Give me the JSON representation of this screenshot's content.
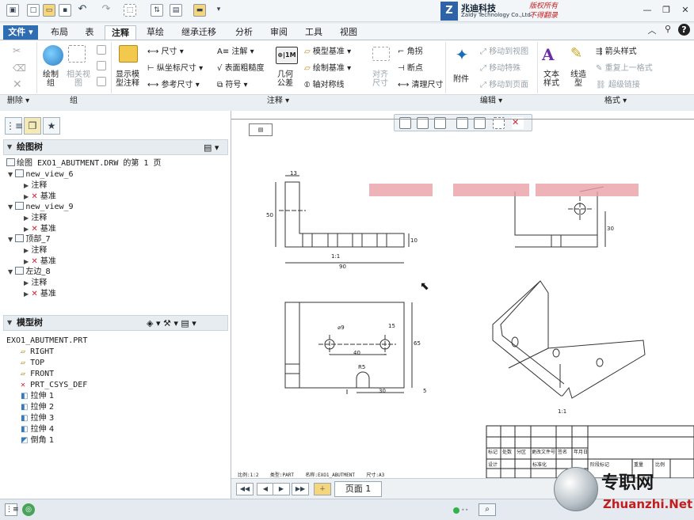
{
  "brand": {
    "name_cn": "兆迪科技",
    "name_en": "Zaldy Technology Co.,Ltd.",
    "slogan1": "版权所有",
    "slogan2": "不得翻录"
  },
  "tabs": [
    "文件",
    "布局",
    "表",
    "注释",
    "草绘",
    "继承迁移",
    "分析",
    "审阅",
    "工具",
    "视图"
  ],
  "active_tab": "注释",
  "ribbon": {
    "delete_group": "删除",
    "group_group": "组",
    "annotation_group": "注释",
    "edit_group": "编辑",
    "format_group": "格式",
    "buttons": {
      "draw_group": "绘制\n组",
      "related_view": "相关视\n图",
      "show_model_annotation": "显示模\n型注释",
      "dimension": "尺寸",
      "ordinate_dimension": "纵坐标尺寸",
      "reference_dimension": "参考尺寸",
      "note": "注解",
      "surface_finish": "表面粗糙度",
      "symbol": "符号",
      "geometric_tolerance": "几何\n公差",
      "model_datum": "模型基准",
      "draw_datum": "绘制基准",
      "axis_symmetry": "轴对称线",
      "align_dimensions": "对齐\n尺寸",
      "corner": "角拐",
      "breakpoint": "断点",
      "cleanup_dimensions": "清理尺寸",
      "attachment": "附件",
      "move_to_view": "移动到视图",
      "move_special": "移动特殊",
      "move_to_page": "移动到页面",
      "text_style": "文本\n样式",
      "line_style": "线造\n型",
      "arrow_style": "箭头样式",
      "repeat_format": "重复上一格式",
      "hyperlink": "超级链接"
    }
  },
  "drawing_tree": {
    "title": "绘图树",
    "root": "绘图 EXO1_ABUTMENT.DRW 的第 1 页",
    "views": [
      {
        "name": "new_view_6",
        "children": [
          "注释",
          "基准"
        ]
      },
      {
        "name": "new_view_9",
        "children": [
          "注释",
          "基准"
        ]
      },
      {
        "name": "顶部_7",
        "children": [
          "注释",
          "基准"
        ]
      },
      {
        "name": "左边_8",
        "children": [
          "注释",
          "基准"
        ]
      }
    ]
  },
  "model_tree": {
    "title": "模型树",
    "root": "EXO1_ABUTMENT.PRT",
    "items": [
      "RIGHT",
      "TOP",
      "FRONT",
      "PRT_CSYS_DEF",
      "拉伸 1",
      "拉伸 2",
      "拉伸 3",
      "拉伸 4",
      "倒角 1"
    ]
  },
  "drawing": {
    "scale_info": "比例:1:2    类型:PART    名称:EXO1_ABUTMENT    尺寸:A3",
    "dim_13": "13",
    "dim_50": "50",
    "dim_90": "90",
    "dim_10": "10",
    "dim_30": "30",
    "dim_phi9": "⌀9",
    "dim_15": "15",
    "dim_40": "40",
    "dim_65": "65",
    "dim_30b": "30",
    "dim_r5": "R5",
    "dim_5": "5",
    "label_iso": "1:1",
    "label_front": "1:1",
    "titleblock": [
      "标记",
      "处数",
      "分区",
      "更改文件号",
      "签名",
      "年月日",
      "设计",
      "标准化",
      "阶段标记",
      "重量",
      "比例"
    ]
  },
  "page_nav": {
    "page_label": "页面 1"
  },
  "watermark": {
    "cn": "专职网",
    "en": "Zhuanzhi.Net"
  }
}
